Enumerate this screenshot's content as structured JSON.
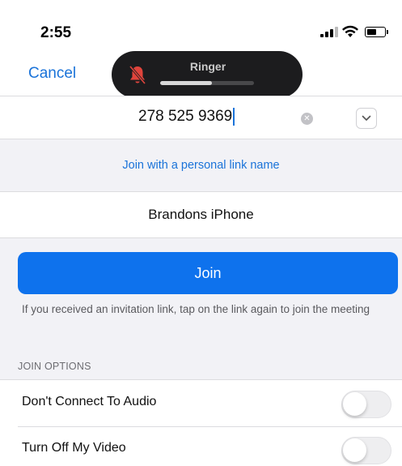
{
  "status_bar": {
    "time": "2:55",
    "signal_bars": 3,
    "battery_level": 0.55
  },
  "nav": {
    "cancel_label": "Cancel"
  },
  "ringer_hud": {
    "label": "Ringer",
    "muted": true,
    "volume": 0.55,
    "icon": "bell-slash-icon",
    "icon_color": "#e0443c"
  },
  "meeting_id": {
    "value": "278 525 9369",
    "clear_icon": "clear-x-icon",
    "dropdown_icon": "chevron-down-icon"
  },
  "personal_link": {
    "label": "Join with a personal link name"
  },
  "name_field": {
    "value": "Brandons iPhone"
  },
  "join": {
    "label": "Join",
    "hint": "If you received an invitation link, tap on the link again to join the meeting"
  },
  "join_options": {
    "header": "JOIN OPTIONS",
    "items": [
      {
        "label": "Don't Connect To Audio",
        "on": false
      },
      {
        "label": "Turn Off My Video",
        "on": false
      }
    ]
  },
  "colors": {
    "accent": "#0e72ed",
    "link": "#1a73d9",
    "background": "#f2f2f6"
  }
}
